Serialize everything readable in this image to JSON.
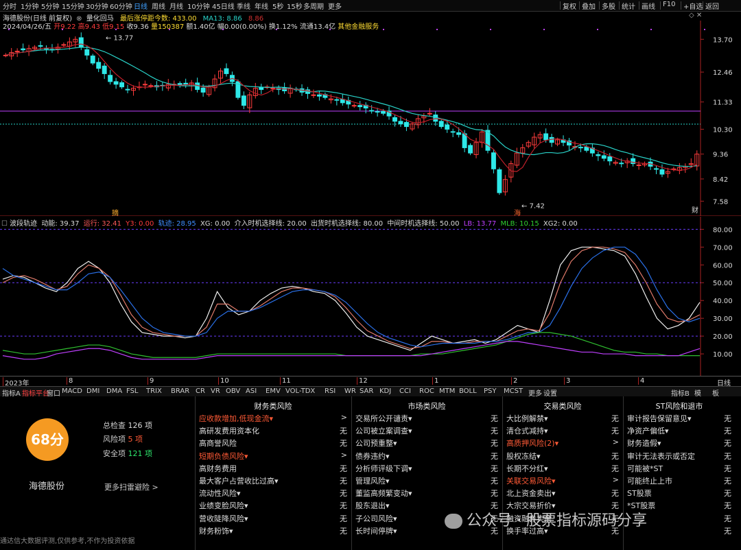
{
  "period_bar": {
    "items": [
      "分时",
      "1分钟",
      "5分钟",
      "15分钟",
      "30分钟",
      "60分钟",
      "日线",
      "周线",
      "月线",
      "10分钟",
      "45日线",
      "季线",
      "年线",
      "5秒",
      "15秒",
      "多周期",
      "更多"
    ],
    "active": "日线",
    "right": [
      "复权",
      "叠加",
      "多股",
      "统计",
      "画线",
      "F10",
      "+自选",
      "返回"
    ]
  },
  "quote": {
    "title": "海德股份(日线 前复权)",
    "indicator_name": "量化回马",
    "zt_label": "最后涨停距今数: 433.00",
    "ma_label": "MA13: 8.86",
    "ma_value2": "8.86",
    "row2_date": "2024/04/26/五",
    "row2_kai": "开9.22",
    "row2_gao": "高9.43",
    "row2_di": "低9.15",
    "row2_shou": "收9.36",
    "row2_liang": "量150387",
    "row2_e": "额1.40亿",
    "row2_fu": "幅0.00(0.00%)",
    "row2_huan": "换1.12%",
    "row2_liutong": "流通13.4亿",
    "row2_other": "其他金融服务"
  },
  "price_axis": {
    "ticks": [
      "13.70",
      "12.46",
      "11.33",
      "10.30",
      "9.36",
      "8.42",
      "7.58"
    ]
  },
  "price_annotations": {
    "high": "13.77",
    "low": "7.42",
    "mark_left": "摘",
    "mark_mid": "海",
    "mark_right": "财"
  },
  "indicator": {
    "name": "波段轨迹",
    "dongneng": "动能: 39.37",
    "yunxing": "运行: 32.41",
    "y3": "Y3: 0.00",
    "guiji": "轨迹: 28.95",
    "xg": "XG: 0.00",
    "jieru": "介入时机选择线: 20.00",
    "chuhuo": "出货时机选择线: 80.00",
    "zhongjian": "中间时机选择线: 50.00",
    "lb": "LB: 13.77",
    "mlb": "MLB: 10.15",
    "xg2": "XG2: 0.00"
  },
  "ind_axis": {
    "ticks": [
      "80.00",
      "70.00",
      "60.00",
      "50.00",
      "40.00",
      "30.00",
      "20.00",
      "10.00"
    ]
  },
  "date_axis": {
    "labels": [
      "2023年",
      "8",
      "9",
      "10",
      "11",
      "12",
      "1",
      "2",
      "3",
      "4"
    ],
    "right": "日线"
  },
  "tabs": {
    "items": [
      "指标A",
      "指标平台",
      "窗口",
      "MACD",
      "DMI",
      "DMA",
      "FSL",
      "TRIX",
      "BRAR",
      "CR",
      "VR",
      "OBV",
      "ASI",
      "EMV",
      "VOL-TDX",
      "RSI",
      "WR",
      "SAR",
      "KDJ",
      "CCI",
      "ROC",
      "MTM",
      "BOLL",
      "PSY",
      "MCST",
      "更多",
      "设置"
    ],
    "active": "指标平台",
    "right": [
      "指标B",
      "模",
      "板"
    ]
  },
  "score": {
    "value": "68分",
    "name": "海德股份",
    "total_label": "总检查",
    "total": "126 项",
    "risk_label": "风险项",
    "risk": "5 项",
    "safe_label": "安全项",
    "safe": "121 项",
    "more": "更多扫雷避险 >"
  },
  "columns": [
    {
      "title": "财务类风险",
      "rows": [
        {
          "n": "应收款增加,低现金流▾",
          "v": ">",
          "r": true
        },
        {
          "n": "高研发费用资本化",
          "v": "无",
          "r": false
        },
        {
          "n": "高商誉风险",
          "v": "无",
          "r": false
        },
        {
          "n": "短期负债风险▾",
          "v": ">",
          "r": true
        },
        {
          "n": "高财务费用",
          "v": "无",
          "r": false
        },
        {
          "n": "最大客户占营收比过高▾",
          "v": "无",
          "r": false
        },
        {
          "n": "流动性风险▾",
          "v": "无",
          "r": false
        },
        {
          "n": "业绩变脸风险▾",
          "v": "无",
          "r": false
        },
        {
          "n": "营收陡降风险▾",
          "v": "无",
          "r": false
        },
        {
          "n": "财务粉饰▾",
          "v": "无",
          "r": false
        }
      ]
    },
    {
      "title": "市场类风险",
      "rows": [
        {
          "n": "交易所公开谴责▾",
          "v": "无",
          "r": false
        },
        {
          "n": "公司被立案调查▾",
          "v": "无",
          "r": false
        },
        {
          "n": "公司预重整▾",
          "v": "无",
          "r": false
        },
        {
          "n": "债券违约▾",
          "v": "无",
          "r": false
        },
        {
          "n": "分析师评级下调▾",
          "v": "无",
          "r": false
        },
        {
          "n": "管理风险▾",
          "v": "无",
          "r": false
        },
        {
          "n": "董监高频繁变动▾",
          "v": "无",
          "r": false
        },
        {
          "n": "股东退出▾",
          "v": "无",
          "r": false
        },
        {
          "n": "子公司风险▾",
          "v": "无",
          "r": false
        },
        {
          "n": "长时间停牌▾",
          "v": "无",
          "r": false
        }
      ]
    },
    {
      "title": "交易类风险",
      "rows": [
        {
          "n": "大比例解禁▾",
          "v": "无",
          "r": false
        },
        {
          "n": "清仓式减持▾",
          "v": "无",
          "r": false
        },
        {
          "n": "高质押风险(2)▾",
          "v": ">",
          "r": true
        },
        {
          "n": "股权冻结▾",
          "v": "无",
          "r": false
        },
        {
          "n": "长期不分红▾",
          "v": "无",
          "r": false
        },
        {
          "n": "关联交易风险▾",
          "v": ">",
          "r": true
        },
        {
          "n": "北上资金卖出▾",
          "v": "无",
          "r": false
        },
        {
          "n": "大宗交易折价▾",
          "v": "无",
          "r": false
        },
        {
          "n": "融资融券卖余",
          "v": "无",
          "r": false
        },
        {
          "n": "换手率过高▾",
          "v": "无",
          "r": false
        }
      ]
    },
    {
      "title": "ST风险和退市",
      "rows": [
        {
          "n": "审计报告保留意见▾",
          "v": "无",
          "r": false
        },
        {
          "n": "净资产偏低▾",
          "v": "无",
          "r": false
        },
        {
          "n": "财务造假▾",
          "v": "无",
          "r": false
        },
        {
          "n": "审计无法表示或否定",
          "v": "无",
          "r": false
        },
        {
          "n": "可能被*ST",
          "v": "无",
          "r": false
        },
        {
          "n": "可能终止上市",
          "v": "无",
          "r": false
        },
        {
          "n": "ST股票",
          "v": "无",
          "r": false
        },
        {
          "n": "*ST股票",
          "v": "无",
          "r": false
        },
        {
          "n": "",
          "v": "无",
          "r": false
        },
        {
          "n": "",
          "v": "无",
          "r": false
        }
      ]
    }
  ],
  "footer": {
    "disclaimer": "通达信大数据评测,仅供参考,不作为投资依据"
  },
  "watermark": {
    "text": "公众号 · 股票指标源码分享"
  },
  "colors": {
    "up": "#ff3c3c",
    "down": "#2ee8e8",
    "ma": "#29d3c9",
    "ma2": "#c0202a",
    "purple": "#c040ff",
    "orange": "#ff9a2e"
  },
  "chart_data": [
    {
      "type": "candlestick",
      "title": "海德股份(日线 前复权)",
      "y_ticks": [
        13.7,
        12.46,
        11.33,
        10.3,
        9.36,
        8.42,
        7.58
      ],
      "ylim": [
        7.2,
        14.2
      ],
      "high": 13.77,
      "low": 7.42,
      "close": 9.36,
      "ma13": 8.86,
      "close_series": [
        13.1,
        13.2,
        13.25,
        13.3,
        13.35,
        13.4,
        13.45,
        13.35,
        13.3,
        13.4,
        13.5,
        13.6,
        13.7,
        13.4,
        13.1,
        12.8,
        12.6,
        12.4,
        12.1,
        12.0,
        11.9,
        11.8,
        11.85,
        11.9,
        12.0,
        11.95,
        11.9,
        11.95,
        12.0,
        12.0,
        11.95,
        12.0,
        12.05,
        11.8,
        11.7,
        11.9,
        12.2,
        12.5,
        12.4,
        12.1,
        11.5,
        11.2,
        11.6,
        11.85,
        11.8,
        11.9,
        11.85,
        11.8,
        11.75,
        11.85,
        11.8,
        11.7,
        11.65,
        11.6,
        11.55,
        11.5,
        11.45,
        11.4,
        11.3,
        11.25,
        11.2,
        11.15,
        11.1,
        11.0,
        10.95,
        10.9,
        10.8,
        10.6,
        10.5,
        10.4,
        10.5,
        10.7,
        10.8,
        10.9,
        10.6,
        10.4,
        10.3,
        10.2,
        10.1,
        9.6,
        9.4,
        9.8,
        10.2,
        9.5,
        8.8,
        7.9,
        8.4,
        9.0,
        9.4,
        9.6,
        9.8,
        10.0,
        10.1,
        9.9,
        9.8,
        9.9,
        9.8,
        9.7,
        9.65,
        9.6,
        9.5,
        9.4,
        9.3,
        9.2,
        9.1,
        9.05,
        9.0,
        9.1,
        9.0,
        8.95,
        9.0,
        8.9,
        8.8,
        8.6,
        8.7,
        8.8,
        8.85,
        8.9,
        9.0,
        9.36
      ]
    },
    {
      "type": "line",
      "title": "波段轨迹",
      "y_ticks": [
        80,
        70,
        60,
        50,
        40,
        30,
        20,
        10
      ],
      "ylim": [
        0,
        84
      ],
      "reference_lines": [
        20,
        50,
        80
      ],
      "series": [
        {
          "name": "运行",
          "color": "#f0f0f0",
          "values": [
            52,
            54,
            53,
            50,
            47,
            45,
            50,
            58,
            62,
            58,
            50,
            38,
            28,
            22,
            21,
            20,
            20,
            19,
            20,
            30,
            45,
            36,
            32,
            34,
            40,
            44,
            47,
            48,
            47,
            45,
            44,
            40,
            33,
            25,
            20,
            18,
            16,
            14,
            12,
            16,
            20,
            18,
            16,
            17,
            18,
            16,
            18,
            22,
            26,
            24,
            22,
            40,
            60,
            68,
            70,
            70,
            69,
            68,
            65,
            55,
            42,
            30,
            24,
            26,
            30,
            39
          ]
        },
        {
          "name": "轨迹",
          "color": "#e07a6a",
          "values": [
            50,
            53,
            54,
            52,
            49,
            46,
            48,
            55,
            60,
            58,
            53,
            43,
            32,
            25,
            22,
            21,
            20,
            20,
            20,
            25,
            38,
            38,
            34,
            34,
            37,
            41,
            45,
            47,
            47,
            46,
            45,
            42,
            36,
            29,
            23,
            20,
            17,
            15,
            13,
            14,
            17,
            17,
            16,
            16,
            17,
            17,
            17,
            20,
            23,
            24,
            23,
            33,
            50,
            62,
            68,
            70,
            70,
            69,
            67,
            60,
            50,
            38,
            30,
            28,
            29,
            32
          ]
        },
        {
          "name": "中线",
          "color": "#2a70e8",
          "values": [
            58,
            54,
            52,
            50,
            48,
            46,
            46,
            50,
            55,
            56,
            53,
            46,
            38,
            30,
            25,
            22,
            21,
            20,
            20,
            22,
            30,
            34,
            34,
            34,
            36,
            39,
            42,
            45,
            46,
            46,
            45,
            43,
            39,
            33,
            27,
            22,
            19,
            17,
            15,
            14,
            15,
            16,
            16,
            16,
            16,
            17,
            17,
            18,
            20,
            22,
            22,
            26,
            36,
            48,
            58,
            64,
            68,
            70,
            70,
            66,
            58,
            46,
            36,
            30,
            28,
            30
          ]
        },
        {
          "name": "绿线",
          "color": "#30c030",
          "values": [
            12,
            11,
            10,
            10,
            11,
            12,
            13,
            14,
            15,
            15,
            14,
            12,
            10,
            9,
            8,
            8,
            8,
            8,
            8,
            9,
            10,
            10,
            10,
            10,
            10,
            10,
            10,
            10,
            10,
            10,
            10,
            10,
            9,
            9,
            9,
            9,
            9,
            9,
            9,
            10,
            10,
            10,
            11,
            12,
            13,
            14,
            15,
            17,
            19,
            21,
            22,
            22,
            21,
            20,
            18,
            16,
            14,
            12,
            11,
            11,
            10,
            10,
            9,
            9,
            9,
            9
          ]
        },
        {
          "name": "紫线",
          "color": "#c040ff",
          "values": [
            9,
            8,
            7,
            7,
            8,
            10,
            11,
            12,
            13,
            13,
            12,
            10,
            8,
            7,
            7,
            7,
            7,
            7,
            7,
            8,
            9,
            9,
            9,
            9,
            9,
            9,
            9,
            9,
            9,
            9,
            9,
            9,
            9,
            9,
            9,
            9,
            9,
            9,
            9,
            9,
            10,
            11,
            12,
            13,
            14,
            15,
            16,
            17,
            17,
            16,
            15,
            14,
            13,
            12,
            11,
            11,
            10,
            10,
            10,
            9,
            9,
            9,
            9,
            9,
            11,
            13
          ]
        }
      ]
    }
  ]
}
